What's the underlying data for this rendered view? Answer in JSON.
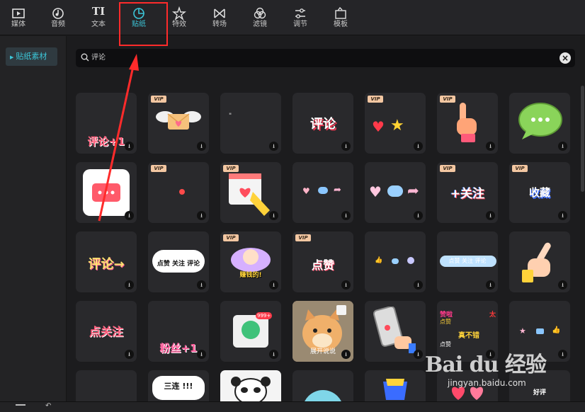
{
  "toolbar": {
    "tabs": [
      {
        "label": "媒体",
        "icon": "media-icon"
      },
      {
        "label": "音频",
        "icon": "audio-icon"
      },
      {
        "label": "文本",
        "icon": "text-icon"
      },
      {
        "label": "贴纸",
        "icon": "sticker-icon",
        "active": true
      },
      {
        "label": "特效",
        "icon": "effects-icon"
      },
      {
        "label": "转场",
        "icon": "transition-icon"
      },
      {
        "label": "滤镜",
        "icon": "filter-icon"
      },
      {
        "label": "调节",
        "icon": "adjust-icon"
      },
      {
        "label": "模板",
        "icon": "template-icon"
      }
    ]
  },
  "sidebar": {
    "items": [
      {
        "label": "贴纸素材"
      }
    ]
  },
  "search": {
    "value": "评论"
  },
  "stickers": {
    "vip_label": "VIP",
    "r1": {
      "s1": "评论+1",
      "s4": "评论"
    },
    "r3": {
      "s1": "评论→",
      "s2a": "点赞 关注 评论",
      "s3": "赚钱的!",
      "s4": "点赞",
      "s6": "点赞 关注 评论"
    },
    "r4": {
      "s1": "点关注",
      "s2": "粉丝+1",
      "s3": "999+",
      "s4": "展开说说",
      "s6a": "赞啦",
      "s6b": "点赞",
      "s6c": "太",
      "s6d": "真不错",
      "s6e": "点赞"
    },
    "r5": {
      "s2": "三连 !!!",
      "s6": "好评"
    }
  },
  "watermark": {
    "brand": "Bai du 经验",
    "url": "jingyan.baidu.com"
  },
  "colors": {
    "accent": "#3cc6d8",
    "annotation": "#ff2b2b",
    "vip": "#f3c7a2"
  }
}
